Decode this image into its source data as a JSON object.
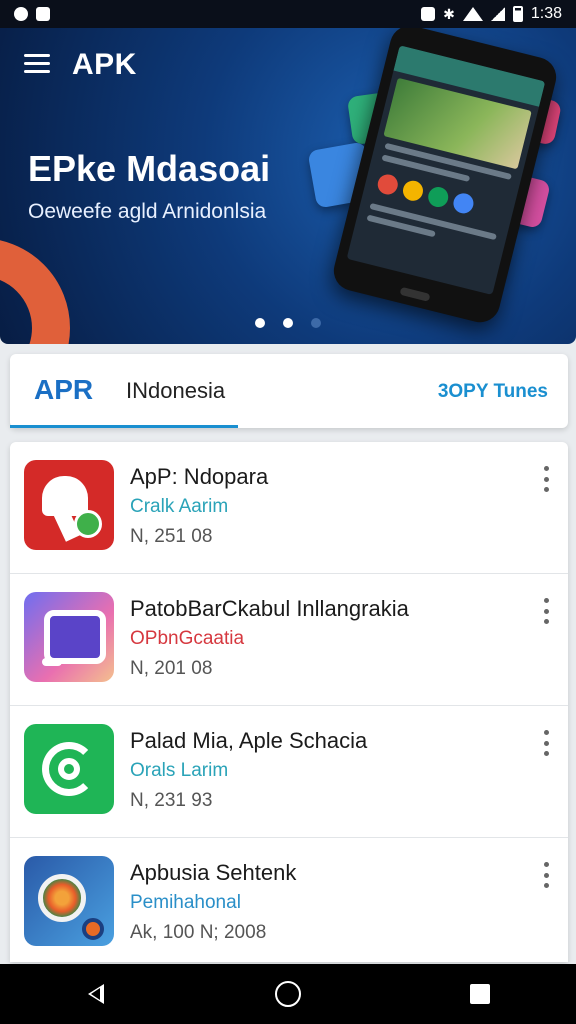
{
  "status_bar": {
    "time": "1:38"
  },
  "header": {
    "app_title": "APK"
  },
  "hero": {
    "title": "EPke Mdasoai",
    "subtitle": "Oeweefe agld Arnidonlsia",
    "active_slide": 2,
    "slide_count": 3
  },
  "tabs": {
    "brand": "APR",
    "location": "INdonesia",
    "right_action": "3OPY Tunes"
  },
  "apps": [
    {
      "name": "ApP: Ndoparа",
      "subtitle": "Cralk Aarim",
      "meta": "N, 251 08",
      "subtitle_color": "#2aa3b8",
      "icon": "red-cloud-shield-icon"
    },
    {
      "name": "PatobBarCkabul Inllangrakia",
      "subtitle": "OPbnGcaatia",
      "meta": "N, 201 08",
      "subtitle_color": "#d6383f",
      "icon": "purple-screen-icon"
    },
    {
      "name": "Palad Mia, Aple Schacia",
      "subtitle": "Orals Larim",
      "meta": "N, 231 93",
      "subtitle_color": "#2aa3b8",
      "icon": "green-rings-icon"
    },
    {
      "name": "Apbusia Sehtenk",
      "subtitle": "Pemihahonal",
      "meta": "Ak, 100 N; 2008",
      "subtitle_color": "#2a8fc8",
      "icon": "blue-lens-icon"
    }
  ]
}
